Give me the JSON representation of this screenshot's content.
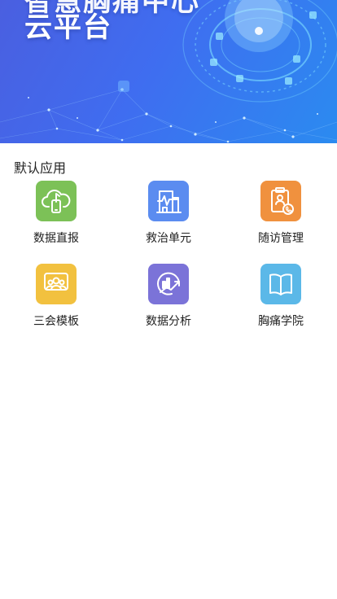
{
  "banner": {
    "title_line1": "智慧胸痛中心",
    "title_line2": "云平台"
  },
  "section": {
    "title": "默认应用"
  },
  "apps": [
    {
      "label": "数据直报",
      "icon": "cloud-phone-icon",
      "color": "#7cc157"
    },
    {
      "label": "救治单元",
      "icon": "hospital-heartbeat-icon",
      "color": "#5b8cf0"
    },
    {
      "label": "随访管理",
      "icon": "clipboard-phone-icon",
      "color": "#f0913e"
    },
    {
      "label": "三会模板",
      "icon": "meeting-people-icon",
      "color": "#f2c13f"
    },
    {
      "label": "数据分析",
      "icon": "chart-analysis-icon",
      "color": "#7b73d8"
    },
    {
      "label": "胸痛学院",
      "icon": "open-book-icon",
      "color": "#5bb8e8"
    }
  ]
}
